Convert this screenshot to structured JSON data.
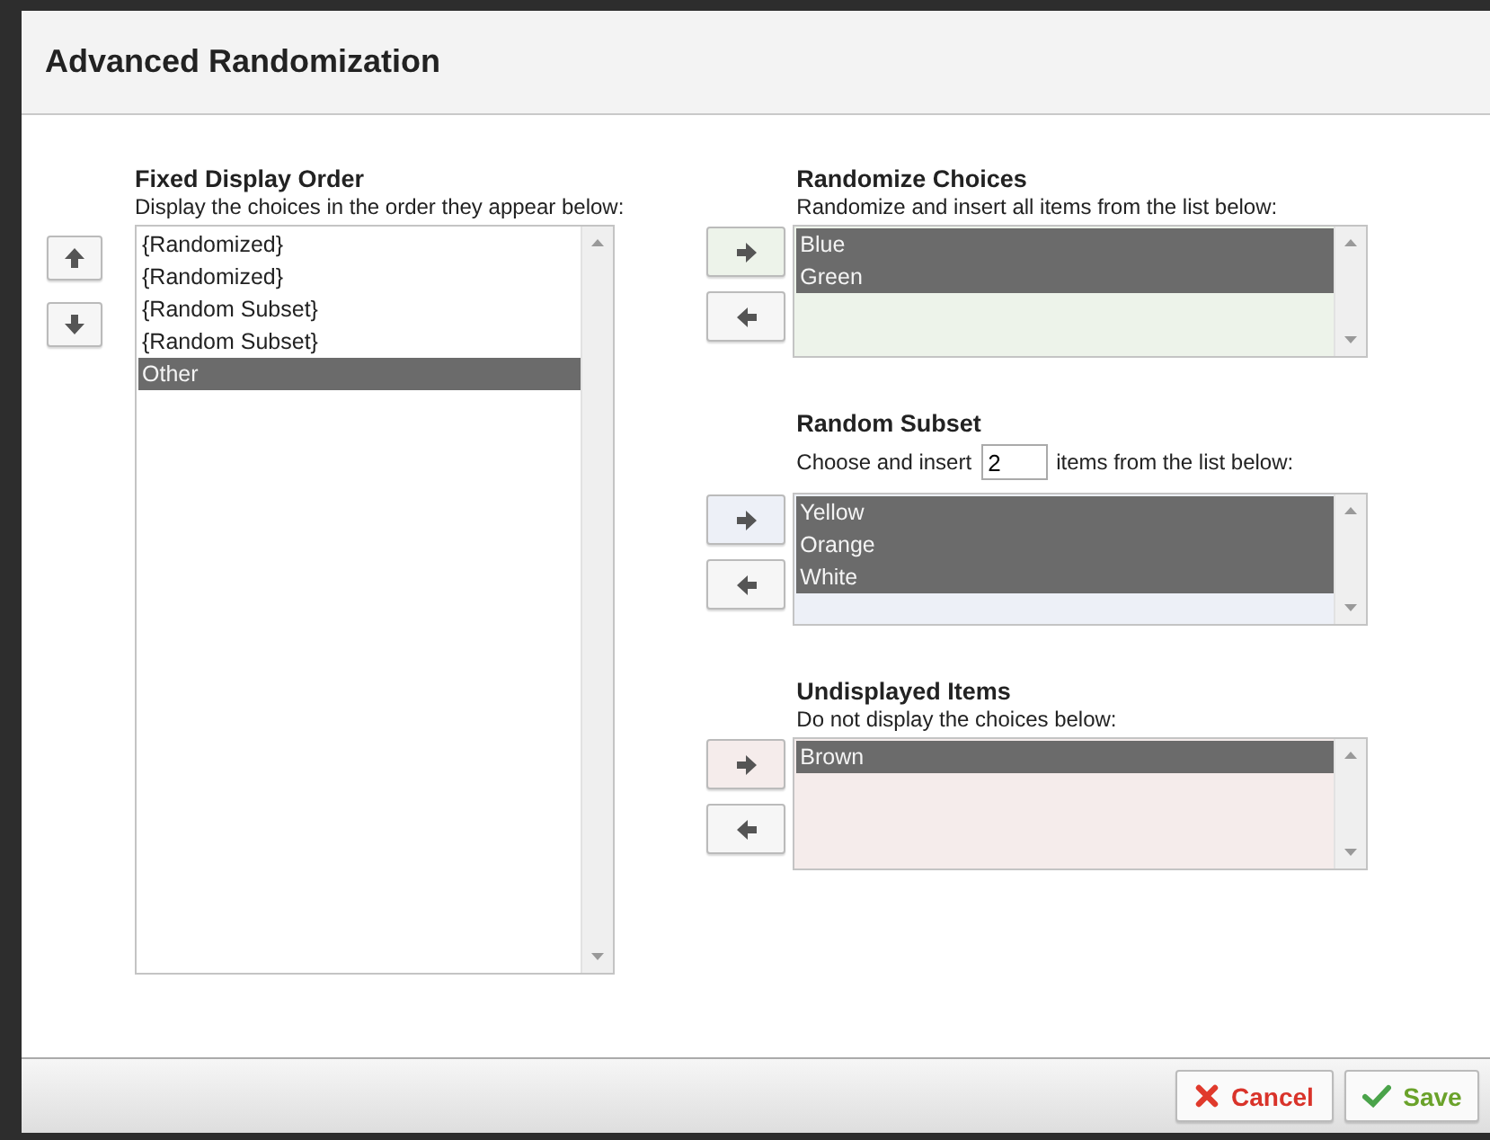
{
  "dialog": {
    "title": "Advanced Randomization"
  },
  "fixed": {
    "title": "Fixed Display Order",
    "description": "Display the choices in the order they appear below:",
    "items": [
      {
        "label": "{Randomized}",
        "selected": false
      },
      {
        "label": "{Randomized}",
        "selected": false
      },
      {
        "label": "{Random Subset}",
        "selected": false
      },
      {
        "label": "{Random Subset}",
        "selected": false
      },
      {
        "label": "Other",
        "selected": true
      }
    ]
  },
  "groups": [
    {
      "kind": "all",
      "title": "Randomize Choices",
      "description": "Randomize and insert all items from the list below:",
      "color": "#edf3ea",
      "items": [
        {
          "label": "Blue",
          "selected": true
        },
        {
          "label": "Green",
          "selected": true
        }
      ]
    },
    {
      "kind": "subset",
      "title": "Random Subset",
      "description": "Choose and insert",
      "count": "2",
      "description_after": "items from the list below:",
      "color": "#edf0f7",
      "items": [
        {
          "label": "Yellow",
          "selected": true
        },
        {
          "label": "Orange",
          "selected": true
        },
        {
          "label": "White",
          "selected": true
        }
      ]
    },
    {
      "kind": "plain",
      "title": "Undisplayed Items",
      "description": "Do not display the choices below:",
      "color": "#f5eceb",
      "items": [
        {
          "label": "Brown",
          "selected": true
        }
      ]
    }
  ],
  "buttons": [
    {
      "kind": "cancel",
      "label": "Cancel"
    },
    {
      "kind": "save",
      "label": "Save"
    }
  ]
}
